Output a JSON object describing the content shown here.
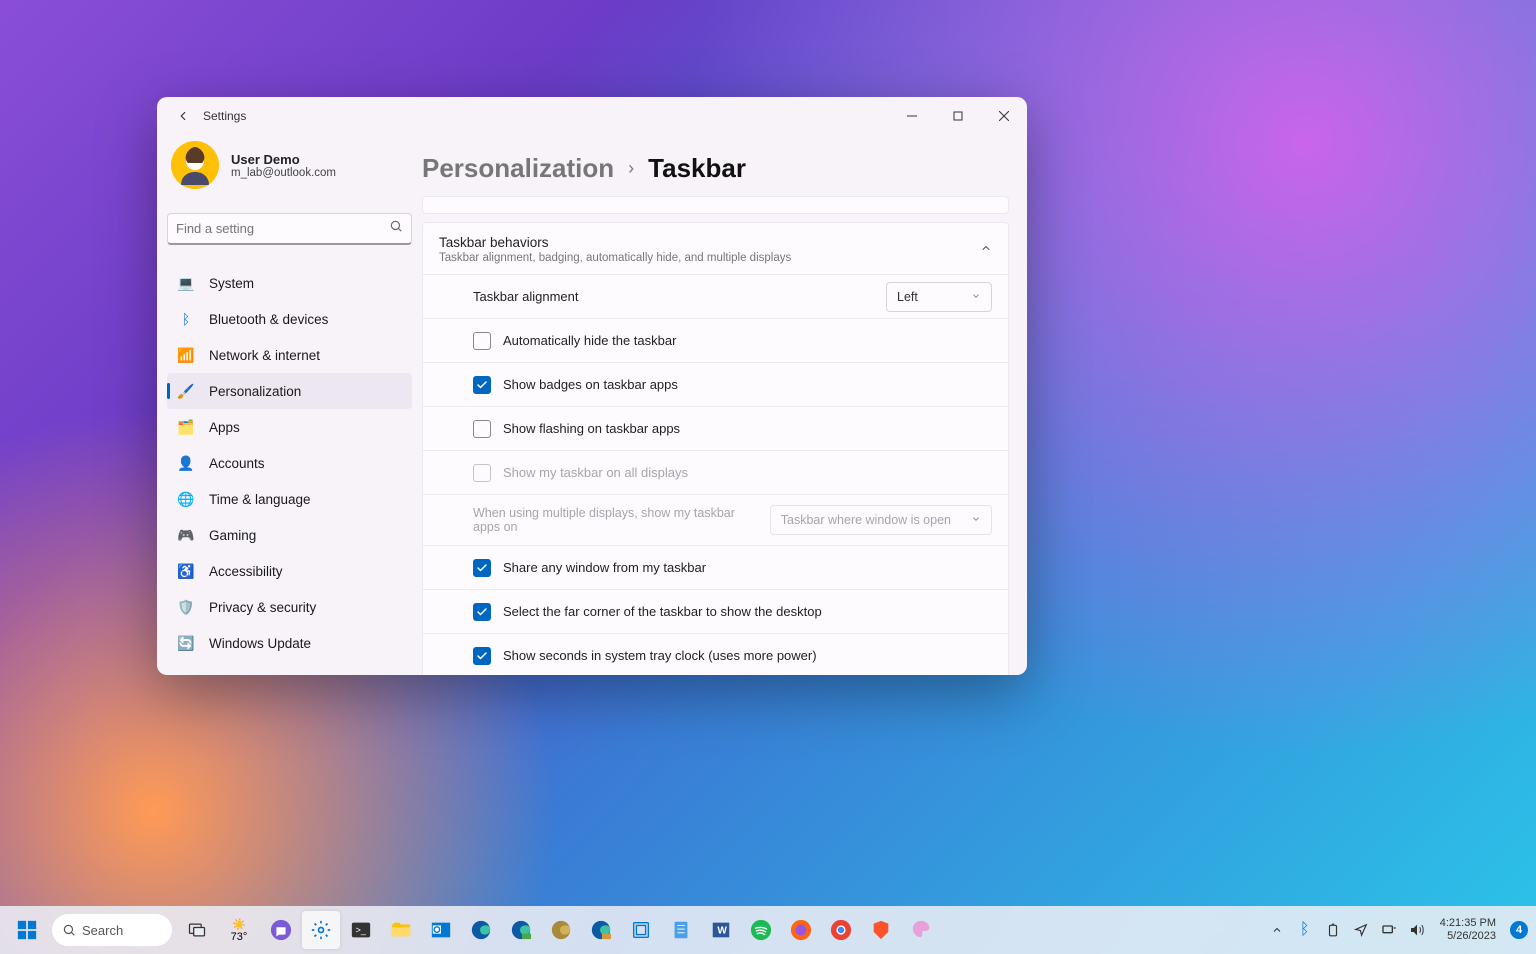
{
  "window": {
    "title": "Settings"
  },
  "profile": {
    "name": "User Demo",
    "email": "m_lab@outlook.com"
  },
  "search": {
    "placeholder": "Find a setting"
  },
  "nav": {
    "items": [
      "System",
      "Bluetooth & devices",
      "Network & internet",
      "Personalization",
      "Apps",
      "Accounts",
      "Time & language",
      "Gaming",
      "Accessibility",
      "Privacy & security",
      "Windows Update"
    ],
    "active_index": 3
  },
  "breadcrumb": {
    "parent": "Personalization",
    "current": "Taskbar"
  },
  "section": {
    "title": "Taskbar behaviors",
    "desc": "Taskbar alignment, badging, automatically hide, and multiple displays"
  },
  "alignment": {
    "label": "Taskbar alignment",
    "value": "Left"
  },
  "options": {
    "auto_hide": {
      "label": "Automatically hide the taskbar",
      "checked": false
    },
    "badges": {
      "label": "Show badges on taskbar apps",
      "checked": true
    },
    "flashing": {
      "label": "Show flashing on taskbar apps",
      "checked": false
    },
    "all_displays": {
      "label": "Show my taskbar on all displays",
      "checked": false,
      "disabled": true
    },
    "multi_displays": {
      "label": "When using multiple displays, show my taskbar apps on",
      "value": "Taskbar where window is open",
      "disabled": true
    },
    "share_window": {
      "label": "Share any window from my taskbar",
      "checked": true
    },
    "far_corner": {
      "label": "Select the far corner of the taskbar to show the desktop",
      "checked": true
    },
    "show_seconds": {
      "label": "Show seconds in system tray clock (uses more power)",
      "checked": true
    }
  },
  "taskbar": {
    "search": "Search",
    "weather_temp": "73°",
    "clock_time": "4:21:35 PM",
    "clock_date": "5/26/2023",
    "notif_count": "4"
  }
}
